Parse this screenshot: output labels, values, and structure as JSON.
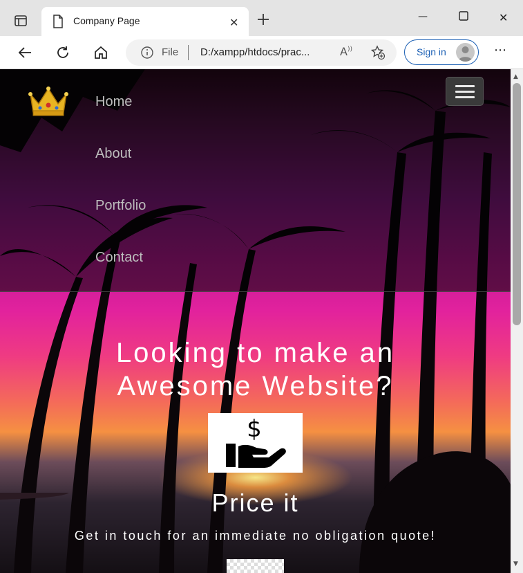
{
  "browser": {
    "tab_title": "Company Page",
    "tab_close": "✕",
    "new_tab": "+",
    "minimize": "—",
    "maximize": "☐",
    "close": "✕",
    "file_label": "File",
    "url": "D:/xampp/htdocs/prac...",
    "read_aloud": "A)",
    "sign_in": "Sign in",
    "more": "⋯"
  },
  "nav": {
    "items": [
      {
        "label": "Home"
      },
      {
        "label": "About"
      },
      {
        "label": "Portfolio"
      },
      {
        "label": "Contact"
      }
    ]
  },
  "hero": {
    "heading_line1": "Looking to make an",
    "heading_line2": "Awesome Website?",
    "price_symbol": "$",
    "price_title": "Price it",
    "price_subtitle": "Get in touch for an immediate no obligation quote!"
  },
  "colors": {
    "accent": "#1a5fb4",
    "nav_text": "#bdbdbd",
    "hero_text": "#ffffff"
  },
  "icons": [
    "sidebar-toggle-icon",
    "document-icon",
    "back-arrow-icon",
    "refresh-icon",
    "home-icon",
    "info-icon",
    "read-aloud-icon",
    "favorite-add-icon",
    "profile-icon",
    "crown-logo-icon",
    "hamburger-menu-icon",
    "hand-money-icon"
  ]
}
